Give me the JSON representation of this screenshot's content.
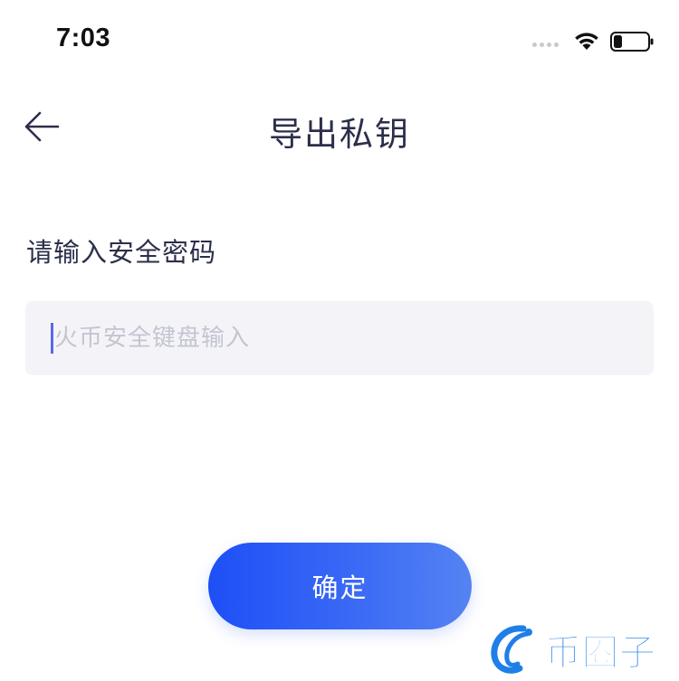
{
  "status_bar": {
    "time": "7:03",
    "wifi": "wifi-icon",
    "battery": "battery-low-icon"
  },
  "nav": {
    "title": "导出私钥",
    "back_icon": "arrow-left-icon"
  },
  "form": {
    "label": "请输入安全密码",
    "input_placeholder": "火币安全键盘输入",
    "input_value": ""
  },
  "actions": {
    "confirm_label": "确定"
  },
  "watermark": {
    "text": "币圈子"
  },
  "colors": {
    "accent": "#1e4ff6",
    "title_text": "#2b2f4a",
    "input_bg": "#f4f4f8",
    "placeholder": "#c3c5d0",
    "watermark": "#1f7fe8"
  }
}
